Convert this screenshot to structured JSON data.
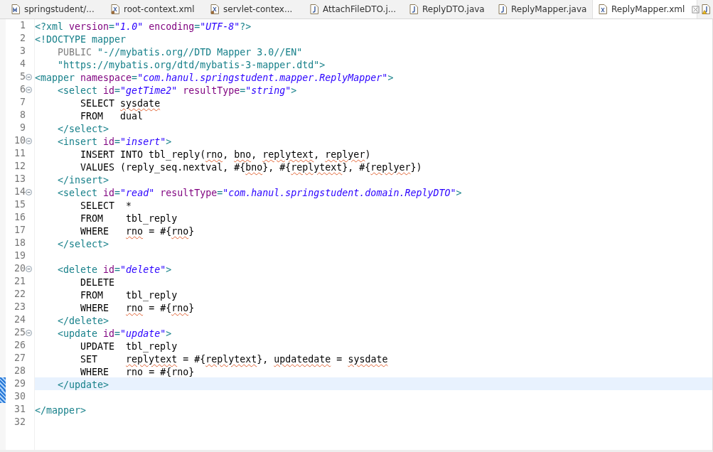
{
  "tabs": [
    {
      "label": "springstudent/...",
      "kind": "maven",
      "selected": false
    },
    {
      "label": "root-context.xml",
      "kind": "xml",
      "selected": false
    },
    {
      "label": "servlet-contex...",
      "kind": "xml",
      "selected": false
    },
    {
      "label": "AttachFileDTO.j...",
      "kind": "java",
      "selected": false
    },
    {
      "label": "ReplyDTO.java",
      "kind": "java",
      "selected": false
    },
    {
      "label": "ReplyMapper.java",
      "kind": "java",
      "selected": false
    },
    {
      "label": "ReplyMapper.xml",
      "kind": "xmlplain",
      "selected": true
    }
  ],
  "lines": [
    {
      "number": "1",
      "fold": false,
      "changed": false,
      "selected": false,
      "tokens": [
        {
          "kind": "tag",
          "text": "<?xml "
        },
        {
          "kind": "attr",
          "text": "version"
        },
        {
          "kind": "tag",
          "text": "="
        },
        {
          "kind": "val",
          "text": "\"1.0\" "
        },
        {
          "kind": "attr",
          "text": "encoding"
        },
        {
          "kind": "tag",
          "text": "="
        },
        {
          "kind": "val",
          "text": "\"UTF-8\""
        },
        {
          "kind": "tag",
          "text": "?>"
        }
      ]
    },
    {
      "number": "2",
      "fold": false,
      "changed": false,
      "selected": false,
      "tokens": [
        {
          "kind": "tag",
          "text": "<!DOCTYPE mapper"
        }
      ]
    },
    {
      "number": "3",
      "fold": false,
      "changed": false,
      "selected": false,
      "tokens": [
        {
          "kind": "dtd",
          "text": "    PUBLIC "
        },
        {
          "kind": "tag",
          "text": "\"-//mybatis.org//DTD Mapper 3.0//EN\""
        }
      ]
    },
    {
      "number": "4",
      "fold": false,
      "changed": false,
      "selected": false,
      "tokens": [
        {
          "kind": "tag",
          "text": "    \"https://mybatis.org/dtd/mybatis-3-mapper.dtd\">"
        }
      ]
    },
    {
      "number": "5",
      "fold": true,
      "changed": false,
      "selected": false,
      "tokens": [
        {
          "kind": "tag",
          "text": "<mapper "
        },
        {
          "kind": "attr",
          "text": "namespace"
        },
        {
          "kind": "tag",
          "text": "="
        },
        {
          "kind": "val",
          "text": "\"com.hanul.springstudent.mapper.ReplyMapper\""
        },
        {
          "kind": "tag",
          "text": ">"
        }
      ]
    },
    {
      "number": "6",
      "fold": true,
      "changed": false,
      "selected": false,
      "tokens": [
        {
          "kind": "tag",
          "text": "    <select "
        },
        {
          "kind": "attr",
          "text": "id"
        },
        {
          "kind": "tag",
          "text": "="
        },
        {
          "kind": "val",
          "text": "\"getTime2\" "
        },
        {
          "kind": "attr",
          "text": "resultType"
        },
        {
          "kind": "tag",
          "text": "="
        },
        {
          "kind": "val",
          "text": "\"string\""
        },
        {
          "kind": "tag",
          "text": ">"
        }
      ]
    },
    {
      "number": "7",
      "fold": false,
      "changed": false,
      "selected": false,
      "tokens": [
        {
          "kind": "text",
          "text": "        SELECT "
        },
        {
          "kind": "spell",
          "text": "sysdate"
        }
      ]
    },
    {
      "number": "8",
      "fold": false,
      "changed": false,
      "selected": false,
      "tokens": [
        {
          "kind": "text",
          "text": "        FROM   dual"
        }
      ]
    },
    {
      "number": "9",
      "fold": false,
      "changed": false,
      "selected": false,
      "tokens": [
        {
          "kind": "tag",
          "text": "    </select>"
        }
      ]
    },
    {
      "number": "10",
      "fold": true,
      "changed": false,
      "selected": false,
      "tokens": [
        {
          "kind": "tag",
          "text": "    <insert "
        },
        {
          "kind": "attr",
          "text": "id"
        },
        {
          "kind": "tag",
          "text": "="
        },
        {
          "kind": "val",
          "text": "\"insert\""
        },
        {
          "kind": "tag",
          "text": ">"
        }
      ]
    },
    {
      "number": "11",
      "fold": false,
      "changed": false,
      "selected": false,
      "tokens": [
        {
          "kind": "text",
          "text": "        INSERT INTO tbl_reply("
        },
        {
          "kind": "spell",
          "text": "rno"
        },
        {
          "kind": "text",
          "text": ", "
        },
        {
          "kind": "spell",
          "text": "bno"
        },
        {
          "kind": "text",
          "text": ", "
        },
        {
          "kind": "spell",
          "text": "replytext"
        },
        {
          "kind": "text",
          "text": ", "
        },
        {
          "kind": "spell",
          "text": "replyer"
        },
        {
          "kind": "text",
          "text": ")"
        }
      ]
    },
    {
      "number": "12",
      "fold": false,
      "changed": false,
      "selected": false,
      "tokens": [
        {
          "kind": "text",
          "text": "        VALUES (reply_seq.nextval, #{"
        },
        {
          "kind": "spell",
          "text": "bno"
        },
        {
          "kind": "text",
          "text": "}, #{"
        },
        {
          "kind": "spell",
          "text": "replytext"
        },
        {
          "kind": "text",
          "text": "}, #{"
        },
        {
          "kind": "spell",
          "text": "replyer"
        },
        {
          "kind": "text",
          "text": "})"
        }
      ]
    },
    {
      "number": "13",
      "fold": false,
      "changed": false,
      "selected": false,
      "tokens": [
        {
          "kind": "tag",
          "text": "    </insert>"
        }
      ]
    },
    {
      "number": "14",
      "fold": true,
      "changed": false,
      "selected": false,
      "tokens": [
        {
          "kind": "tag",
          "text": "    <select "
        },
        {
          "kind": "attr",
          "text": "id"
        },
        {
          "kind": "tag",
          "text": "="
        },
        {
          "kind": "val",
          "text": "\"read\" "
        },
        {
          "kind": "attr",
          "text": "resultType"
        },
        {
          "kind": "tag",
          "text": "="
        },
        {
          "kind": "val",
          "text": "\"com.hanul.springstudent.domain.ReplyDTO\""
        },
        {
          "kind": "tag",
          "text": ">"
        }
      ]
    },
    {
      "number": "15",
      "fold": false,
      "changed": false,
      "selected": false,
      "tokens": [
        {
          "kind": "text",
          "text": "        SELECT  *"
        }
      ]
    },
    {
      "number": "16",
      "fold": false,
      "changed": false,
      "selected": false,
      "tokens": [
        {
          "kind": "text",
          "text": "        FROM    tbl_reply"
        }
      ]
    },
    {
      "number": "17",
      "fold": false,
      "changed": false,
      "selected": false,
      "tokens": [
        {
          "kind": "text",
          "text": "        WHERE   "
        },
        {
          "kind": "spell",
          "text": "rno"
        },
        {
          "kind": "text",
          "text": " = #{"
        },
        {
          "kind": "spell",
          "text": "rno"
        },
        {
          "kind": "text",
          "text": "}"
        }
      ]
    },
    {
      "number": "18",
      "fold": false,
      "changed": false,
      "selected": false,
      "tokens": [
        {
          "kind": "tag",
          "text": "    </select>"
        }
      ]
    },
    {
      "number": "19",
      "fold": false,
      "changed": false,
      "selected": false
    },
    {
      "number": "20",
      "fold": true,
      "changed": false,
      "selected": false,
      "tokens": [
        {
          "kind": "tag",
          "text": "    <delete "
        },
        {
          "kind": "attr",
          "text": "id"
        },
        {
          "kind": "tag",
          "text": "="
        },
        {
          "kind": "val",
          "text": "\"delete\""
        },
        {
          "kind": "tag",
          "text": ">"
        }
      ]
    },
    {
      "number": "21",
      "fold": false,
      "changed": false,
      "selected": false,
      "tokens": [
        {
          "kind": "text",
          "text": "        DELETE"
        }
      ]
    },
    {
      "number": "22",
      "fold": false,
      "changed": false,
      "selected": false,
      "tokens": [
        {
          "kind": "text",
          "text": "        FROM    tbl_reply"
        }
      ]
    },
    {
      "number": "23",
      "fold": false,
      "changed": false,
      "selected": false,
      "tokens": [
        {
          "kind": "text",
          "text": "        WHERE   "
        },
        {
          "kind": "spell",
          "text": "rno"
        },
        {
          "kind": "text",
          "text": " = #{"
        },
        {
          "kind": "spell",
          "text": "rno"
        },
        {
          "kind": "text",
          "text": "}"
        }
      ]
    },
    {
      "number": "24",
      "fold": false,
      "changed": false,
      "selected": false,
      "tokens": [
        {
          "kind": "tag",
          "text": "    </delete>"
        }
      ]
    },
    {
      "number": "25",
      "fold": true,
      "changed": false,
      "selected": false,
      "tokens": [
        {
          "kind": "tag",
          "text": "    <update "
        },
        {
          "kind": "attr",
          "text": "id"
        },
        {
          "kind": "tag",
          "text": "="
        },
        {
          "kind": "val",
          "text": "\"update\""
        },
        {
          "kind": "tag",
          "text": ">"
        }
      ]
    },
    {
      "number": "26",
      "fold": false,
      "changed": false,
      "selected": false,
      "tokens": [
        {
          "kind": "text",
          "text": "        UPDATE  tbl_reply"
        }
      ]
    },
    {
      "number": "27",
      "fold": false,
      "changed": false,
      "selected": false,
      "tokens": [
        {
          "kind": "text",
          "text": "        SET     "
        },
        {
          "kind": "spell",
          "text": "replytext"
        },
        {
          "kind": "text",
          "text": " = #{"
        },
        {
          "kind": "spell",
          "text": "replytext"
        },
        {
          "kind": "text",
          "text": "}, "
        },
        {
          "kind": "spell",
          "text": "updatedate"
        },
        {
          "kind": "text",
          "text": " = "
        },
        {
          "kind": "spell",
          "text": "sysdate"
        }
      ]
    },
    {
      "number": "28",
      "fold": false,
      "changed": false,
      "selected": false,
      "tokens": [
        {
          "kind": "text",
          "text": "        WHERE   "
        },
        {
          "kind": "spell",
          "text": "rno"
        },
        {
          "kind": "text",
          "text": " = #{"
        },
        {
          "kind": "spell",
          "text": "rno"
        },
        {
          "kind": "text",
          "text": "}"
        }
      ]
    },
    {
      "number": "29",
      "fold": false,
      "changed": true,
      "selected": true,
      "tokens": [
        {
          "kind": "tag",
          "text": "    </update>"
        }
      ]
    },
    {
      "number": "30",
      "fold": false,
      "changed": true,
      "selected": false
    },
    {
      "number": "31",
      "fold": false,
      "changed": false,
      "selected": false,
      "tokens": [
        {
          "kind": "tag",
          "text": "</mapper>"
        }
      ]
    },
    {
      "number": "32",
      "fold": false,
      "changed": false,
      "selected": false
    }
  ]
}
